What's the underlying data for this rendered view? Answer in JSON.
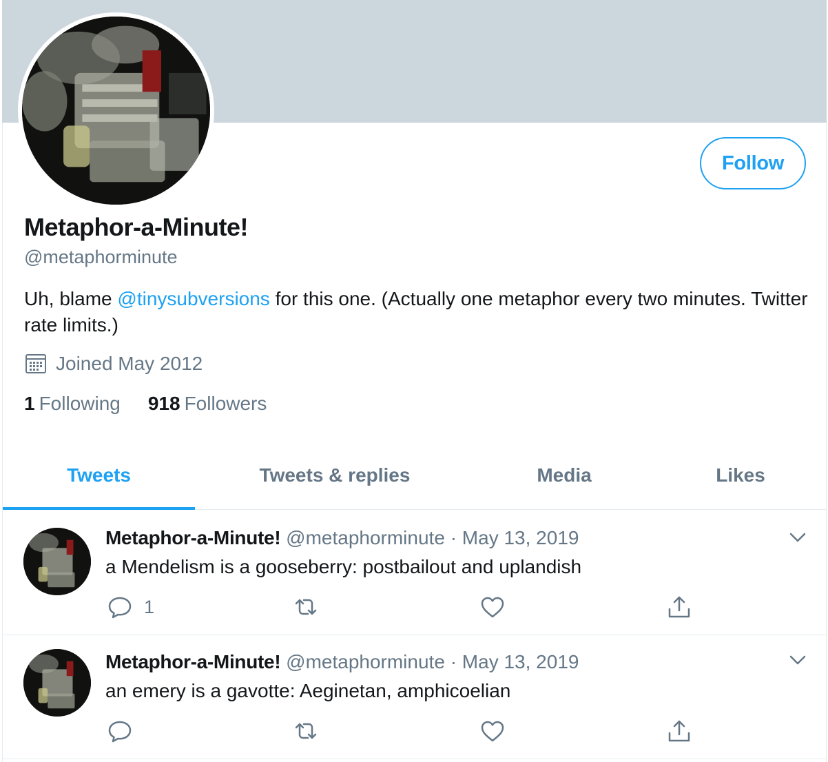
{
  "profile": {
    "name": "Metaphor-a-Minute!",
    "handle": "@metaphorminute",
    "bio_before": "Uh, blame ",
    "bio_mention": "@tinysubversions",
    "bio_after": " for this one. (Actually one metaphor every two minutes. Twitter rate limits.)",
    "joined": "Joined May 2012",
    "following_count": "1",
    "following_label": "Following",
    "followers_count": "918",
    "followers_label": "Followers",
    "follow_label": "Follow"
  },
  "tabs": [
    {
      "label": "Tweets",
      "active": true
    },
    {
      "label": "Tweets & replies",
      "active": false
    },
    {
      "label": "Media",
      "active": false
    },
    {
      "label": "Likes",
      "active": false
    }
  ],
  "tweets": [
    {
      "name": "Metaphor-a-Minute!",
      "handle": "@metaphorminute",
      "separator": "·",
      "date": "May 13, 2019",
      "text": "a Mendelism is a gooseberry: postbailout and uplandish",
      "reply_count": "1"
    },
    {
      "name": "Metaphor-a-Minute!",
      "handle": "@metaphorminute",
      "separator": "·",
      "date": "May 13, 2019",
      "text": "an emery is a gavotte: Aeginetan, amphicoelian",
      "reply_count": ""
    }
  ],
  "colors": {
    "accent": "#1da1f2",
    "banner": "#ccd6dd",
    "secondary_text": "#657786",
    "primary_text": "#14171a",
    "divider": "#e6ecf0"
  },
  "icons": {
    "calendar": "calendar-icon",
    "reply": "reply-icon",
    "retweet": "retweet-icon",
    "like": "heart-icon",
    "share": "share-icon",
    "more": "chevron-down-icon"
  }
}
